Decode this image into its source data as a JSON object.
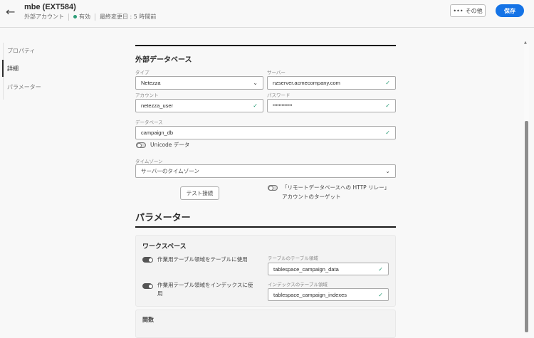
{
  "header": {
    "title": "mbe (EXT584)",
    "type": "外部アカウント",
    "status": "有効",
    "modified": "最終変更日 : 5 時間前",
    "more_label": "その他",
    "save_label": "保存",
    "status_color": "#2d9d78",
    "accent": "#1473e6"
  },
  "sidebar": {
    "items": [
      {
        "label": "プロパティ"
      },
      {
        "label": "詳細"
      },
      {
        "label": "パラメーター"
      }
    ]
  },
  "external_db": {
    "heading": "外部データベース",
    "type_label": "タイプ",
    "type_value": "Netezza",
    "server_label": "サーバー",
    "server_value": "nzserver.acmecompany.com",
    "account_label": "アカウント",
    "account_value": "netezza_user",
    "password_label": "パスワード",
    "password_value": "•••••••••••••",
    "database_label": "データベース",
    "database_value": "campaign_db",
    "unicode_label": "Unicode データ",
    "timezone_label": "タイムゾーン",
    "timezone_value": "サーバーのタイムゾーン",
    "test_button": "テスト接続",
    "http_relay_label": "「リモートデータベースへの HTTP リレー」アカウントのターゲット"
  },
  "parameters": {
    "heading": "パラメーター",
    "workspace": {
      "heading": "ワークスペース",
      "toggle1_label": "作業用テーブル領域をテーブルに使用",
      "toggle2_label": "作業用テーブル領域をインデックスに使用",
      "table_ts_label": "テーブルのテーブル領域",
      "table_ts_value": "tablespace_campaign_data",
      "index_ts_label": "インデックスのテーブル領域",
      "index_ts_value": "tablespace_campaign_indexes"
    },
    "functions_heading": "関数"
  }
}
